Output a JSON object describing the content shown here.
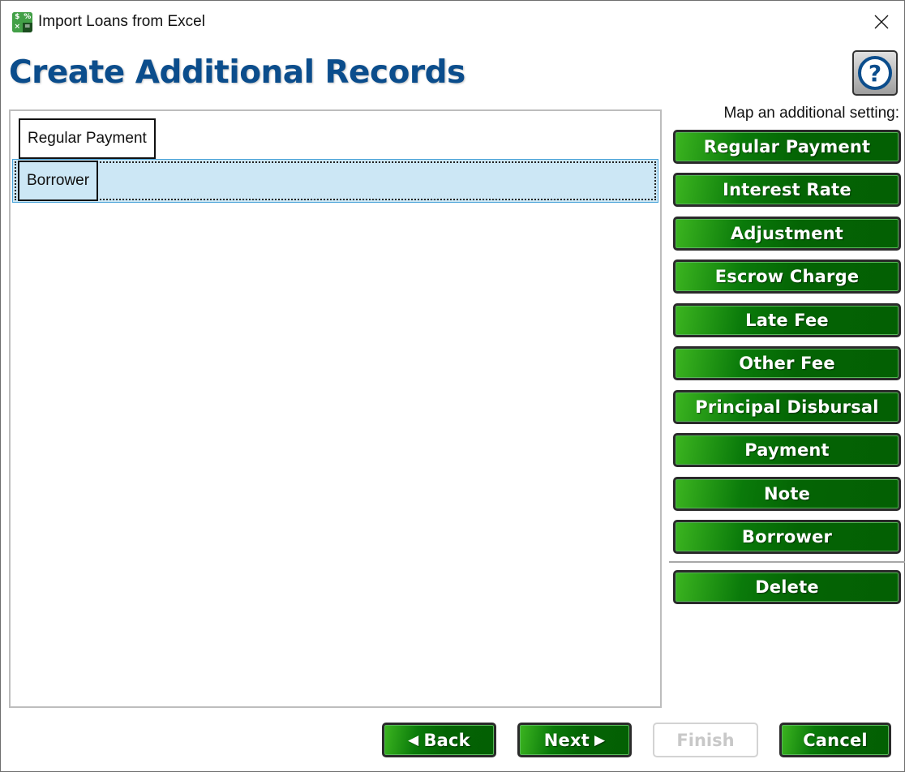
{
  "window": {
    "title": "Import Loans from Excel",
    "app_icon_glyphs": [
      "$",
      "%",
      "×",
      "="
    ],
    "close_icon": "close-icon"
  },
  "header": {
    "page_title": "Create Additional Records",
    "help_glyph": "?"
  },
  "records": [
    {
      "label": "Regular Payment",
      "selected": false
    },
    {
      "label": "Borrower",
      "selected": true
    }
  ],
  "sidebar": {
    "label": "Map an additional setting:",
    "buttons": [
      {
        "label": "Regular Payment"
      },
      {
        "label": "Interest Rate"
      },
      {
        "label": "Adjustment"
      },
      {
        "label": "Escrow Charge"
      },
      {
        "label": "Late Fee"
      },
      {
        "label": "Other Fee"
      },
      {
        "label": "Principal Disbursal"
      },
      {
        "label": "Payment"
      },
      {
        "label": "Note"
      },
      {
        "label": "Borrower"
      }
    ],
    "delete_label": "Delete"
  },
  "footer": {
    "back_label": "Back",
    "back_glyph": "◀",
    "next_label": "Next",
    "next_glyph": "▶",
    "finish_label": "Finish",
    "finish_enabled": false,
    "cancel_label": "Cancel"
  },
  "colors": {
    "title_blue": "#0b4d8c",
    "button_green": "#046404",
    "selection_bg": "#cce7f5",
    "selection_border": "#4aa3d8"
  }
}
